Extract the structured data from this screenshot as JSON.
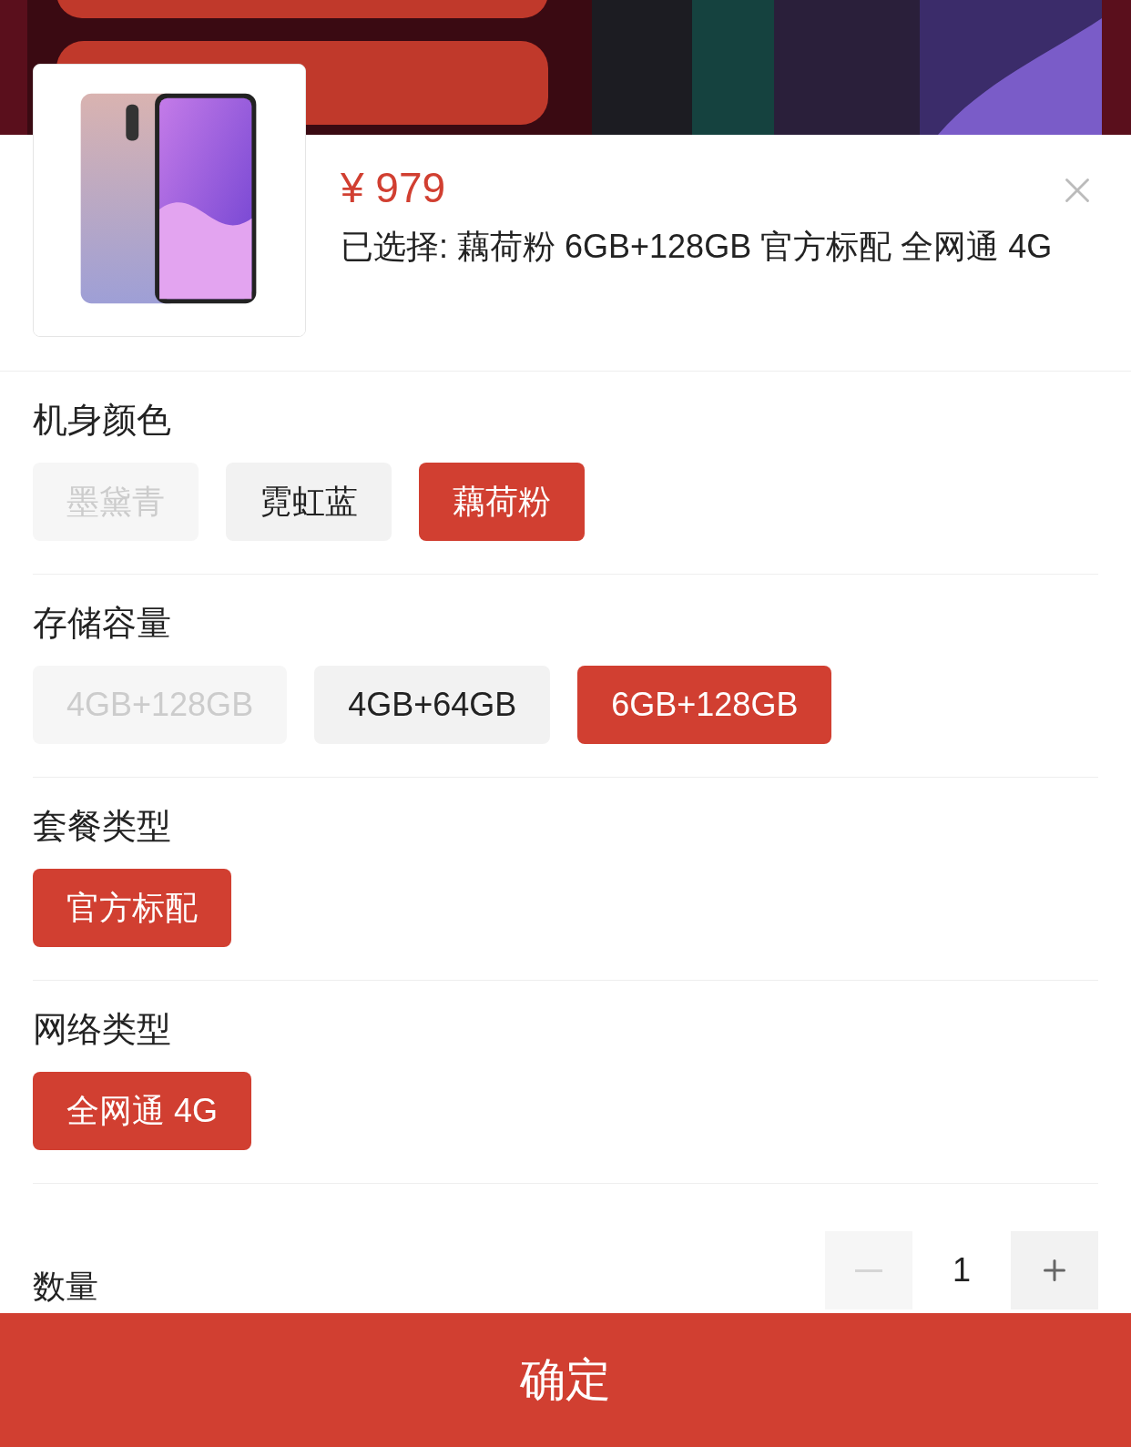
{
  "product": {
    "price": "¥ 979",
    "selected_summary": "已选择: 藕荷粉 6GB+128GB 官方标配 全网通 4G"
  },
  "groups": [
    {
      "title": "机身颜色",
      "options": [
        {
          "label": "墨黛青",
          "disabled": true,
          "selected": false
        },
        {
          "label": "霓虹蓝",
          "disabled": false,
          "selected": false
        },
        {
          "label": "藕荷粉",
          "disabled": false,
          "selected": true
        }
      ]
    },
    {
      "title": "存储容量",
      "options": [
        {
          "label": "4GB+128GB",
          "disabled": true,
          "selected": false
        },
        {
          "label": "4GB+64GB",
          "disabled": false,
          "selected": false
        },
        {
          "label": "6GB+128GB",
          "disabled": false,
          "selected": true
        }
      ]
    },
    {
      "title": "套餐类型",
      "options": [
        {
          "label": "官方标配",
          "disabled": false,
          "selected": true
        }
      ]
    },
    {
      "title": "网络类型",
      "options": [
        {
          "label": "全网通 4G",
          "disabled": false,
          "selected": true
        }
      ]
    }
  ],
  "quantity": {
    "label": "数量",
    "value": "1",
    "minus_disabled": true
  },
  "confirm_button": "确定"
}
